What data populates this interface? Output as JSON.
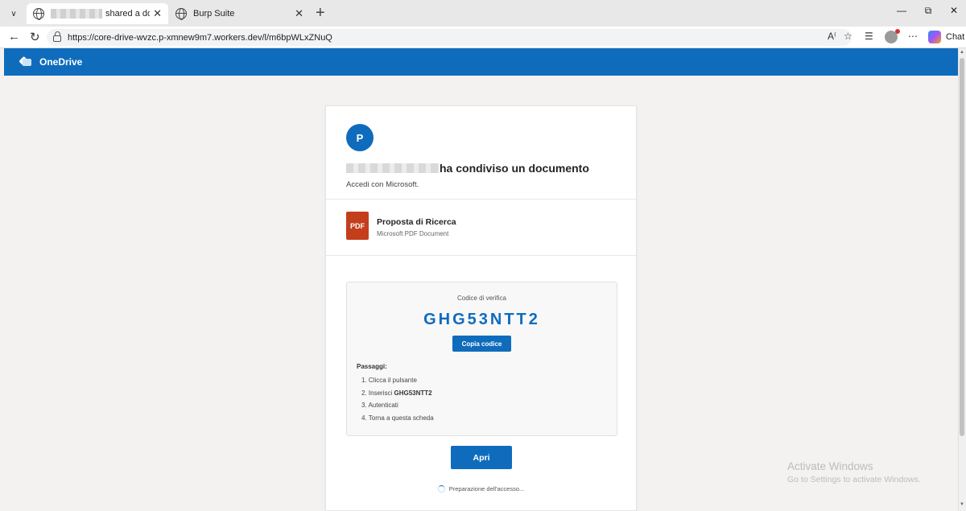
{
  "browser": {
    "tabs": [
      {
        "title": "shared a docume",
        "active": true
      },
      {
        "title": "Burp Suite",
        "active": false
      }
    ],
    "url": "https://core-drive-wvzc.p-xmnew9m7.workers.dev/l/m6bpWLxZNuQ",
    "chat_label": "Chat"
  },
  "header": {
    "title": "OneDrive"
  },
  "card": {
    "avatar_initial": "P",
    "heading_suffix": "ha condiviso un documento",
    "subheading": "Accedi con Microsoft.",
    "file": {
      "icon_label": "PDF",
      "name": "Proposta di Ricerca",
      "type": "Microsoft PDF Document"
    },
    "verification": {
      "label": "Codice di verifica",
      "code": "GHG53NTT2",
      "copy_button": "Copia codice",
      "steps_title": "Passaggi:",
      "steps": [
        {
          "prefix": "1. Clicca il pulsante",
          "bold": ""
        },
        {
          "prefix": "2. Inserisci ",
          "bold": "GHG53NTT2"
        },
        {
          "prefix": "3. Autenticati",
          "bold": ""
        },
        {
          "prefix": "4. Torna a questa scheda",
          "bold": ""
        }
      ]
    },
    "open_button": "Apri",
    "loading_text": "Preparazione dell'accesso..."
  },
  "watermark": {
    "title": "Activate Windows",
    "subtitle": "Go to Settings to activate Windows."
  },
  "colors": {
    "brand": "#0f6cbd",
    "pdf": "#c43e1c"
  }
}
